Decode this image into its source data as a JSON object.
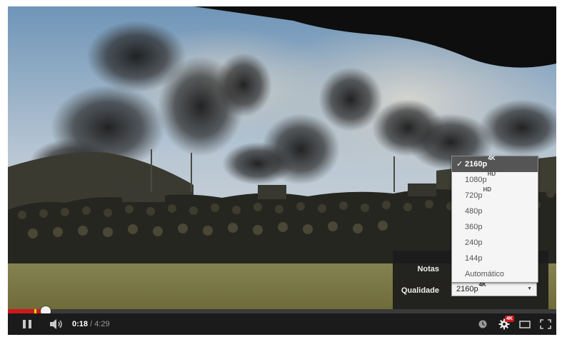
{
  "player": {
    "settings": {
      "notes_label": "Notas",
      "quality_label": "Qualidade",
      "selected_quality": {
        "label": "2160p",
        "badge": "4K"
      },
      "quality_options": [
        {
          "label": "2160p",
          "badge": "4K",
          "selected": true
        },
        {
          "label": "1080p",
          "badge": "HD",
          "selected": false
        },
        {
          "label": "720p",
          "badge": "HD",
          "selected": false
        },
        {
          "label": "480p",
          "badge": "",
          "selected": false
        },
        {
          "label": "360p",
          "badge": "",
          "selected": false
        },
        {
          "label": "240p",
          "badge": "",
          "selected": false
        },
        {
          "label": "144p",
          "badge": "",
          "selected": false
        },
        {
          "label": "Automático",
          "badge": "",
          "selected": false
        }
      ],
      "check_mark": "✓"
    },
    "progress": {
      "played_fraction": 0.0689,
      "buffered_fraction": 0.052
    },
    "time": {
      "current": "0:18",
      "separator": " / ",
      "duration": "4:29"
    },
    "settings_badge": "4K",
    "colors": {
      "accent": "#cc181e",
      "marker": "#f7d000"
    },
    "icons": [
      "pause-icon",
      "volume-icon",
      "watch-later-icon",
      "gear-icon",
      "theater-mode-icon",
      "fullscreen-icon"
    ]
  }
}
